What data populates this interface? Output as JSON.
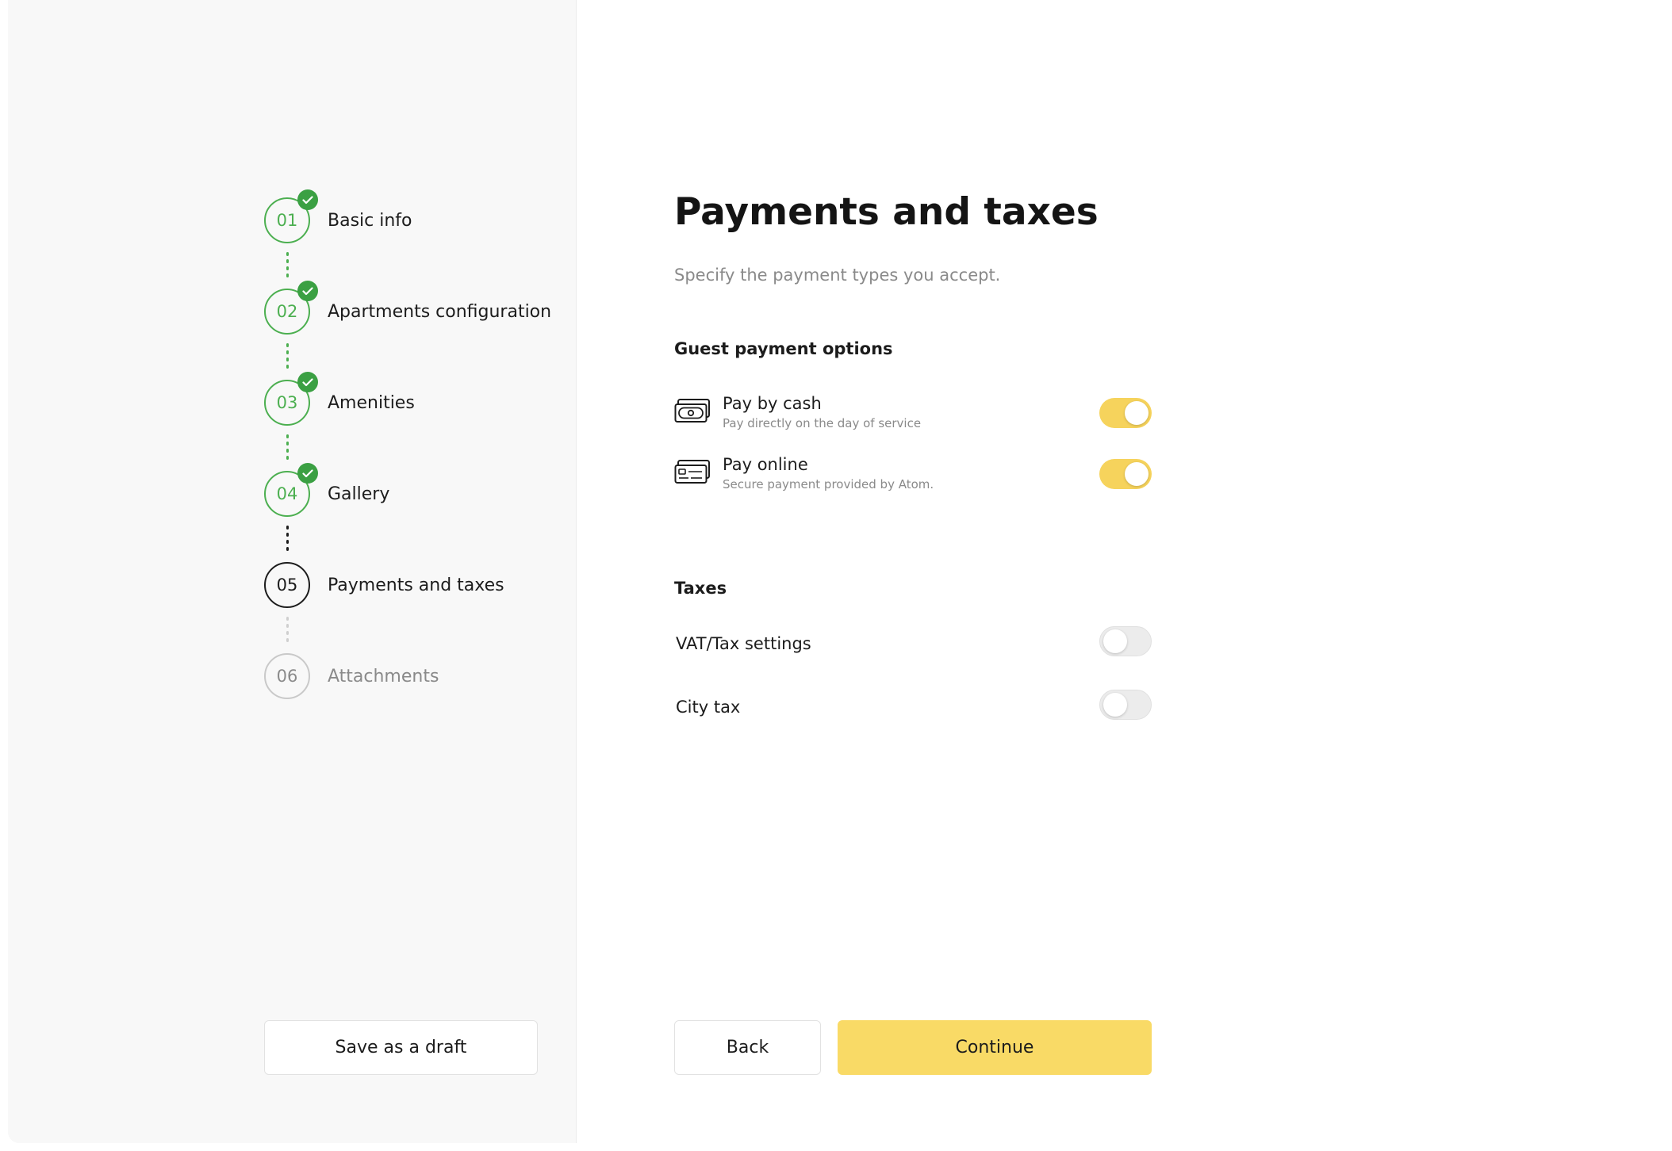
{
  "sidebar": {
    "steps": [
      {
        "number": "01",
        "label": "Basic info",
        "status": "completed"
      },
      {
        "number": "02",
        "label": "Apartments configuration",
        "status": "completed"
      },
      {
        "number": "03",
        "label": "Amenities",
        "status": "completed"
      },
      {
        "number": "04",
        "label": "Gallery",
        "status": "completed"
      },
      {
        "number": "05",
        "label": "Payments and taxes",
        "status": "current"
      },
      {
        "number": "06",
        "label": "Attachments",
        "status": "pending"
      }
    ],
    "save_draft_label": "Save as a draft"
  },
  "main": {
    "title": "Payments and taxes",
    "subtitle": "Specify the payment types you accept.",
    "guest_payment": {
      "heading": "Guest payment options",
      "options": [
        {
          "title": "Pay by cash",
          "description": "Pay directly on the day of service",
          "icon": "cash-icon",
          "enabled": true
        },
        {
          "title": "Pay online",
          "description": "Secure payment provided by Atom.",
          "icon": "credit-card-icon",
          "enabled": true
        }
      ]
    },
    "taxes": {
      "heading": "Taxes",
      "items": [
        {
          "label": "VAT/Tax settings",
          "enabled": false
        },
        {
          "label": "City tax",
          "enabled": false
        }
      ]
    },
    "back_label": "Back",
    "continue_label": "Continue"
  },
  "colors": {
    "completed_green": "#4caf50",
    "check_badge": "#3ba043",
    "accent_yellow": "#f9da66",
    "toggle_on": "#f6d35c",
    "sidebar_bg": "#f8f8f8"
  }
}
